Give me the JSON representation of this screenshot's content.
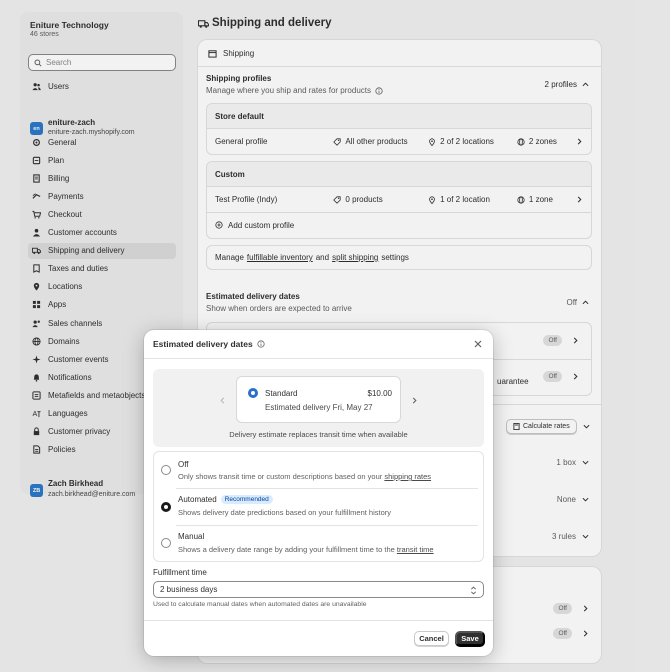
{
  "sidebar": {
    "org_name": "Eniture Technology",
    "org_stores": "46 stores",
    "search_placeholder": "Search",
    "users_label": "Users",
    "store_name": "eniture-zach",
    "store_domain": "eniture-zach.myshopify.com",
    "store_avatar": "en",
    "items": [
      {
        "label": "General",
        "icon": "gear-icon"
      },
      {
        "label": "Plan",
        "icon": "plan-icon"
      },
      {
        "label": "Billing",
        "icon": "billing-icon"
      },
      {
        "label": "Payments",
        "icon": "payments-icon"
      },
      {
        "label": "Checkout",
        "icon": "cart-icon"
      },
      {
        "label": "Customer accounts",
        "icon": "person-icon"
      },
      {
        "label": "Shipping and delivery",
        "icon": "truck-icon"
      },
      {
        "label": "Taxes and duties",
        "icon": "tax-icon"
      },
      {
        "label": "Locations",
        "icon": "location-icon"
      },
      {
        "label": "Apps",
        "icon": "apps-icon"
      },
      {
        "label": "Sales channels",
        "icon": "channels-icon"
      },
      {
        "label": "Domains",
        "icon": "globe-icon"
      },
      {
        "label": "Customer events",
        "icon": "events-icon"
      },
      {
        "label": "Notifications",
        "icon": "bell-icon"
      },
      {
        "label": "Metafields and metaobjects",
        "icon": "metafields-icon"
      },
      {
        "label": "Languages",
        "icon": "language-icon"
      },
      {
        "label": "Customer privacy",
        "icon": "lock-icon"
      },
      {
        "label": "Policies",
        "icon": "policy-icon"
      }
    ],
    "user_name": "Zach Birkhead",
    "user_email": "zach.birkhead@eniture.com",
    "user_initials": "ZB"
  },
  "page": {
    "title": "Shipping and delivery",
    "section_label": "Shipping",
    "profiles_title": "Shipping profiles",
    "profiles_sub": "Manage where you ship and rates for products",
    "profiles_count": "2 profiles",
    "store_default": "Store default",
    "general_profile": "General profile",
    "general_products": "All other products",
    "general_locations": "2 of 2 locations",
    "general_zones": "2 zones",
    "custom": "Custom",
    "test_profile": "Test Profile (Indy)",
    "test_products": "0 products",
    "test_locations": "1 of 2 location",
    "test_zones": "1 zone",
    "add_custom": "Add custom profile",
    "manage_prefix": "Manage",
    "manage_link1": "fulfillable inventory",
    "manage_and": "and",
    "manage_link2": "split shipping",
    "manage_suffix": "settings",
    "edd_title": "Estimated delivery dates",
    "edd_sub": "Show when orders are expected to arrive",
    "edd_status": "Off",
    "edd_row1_badge": "Off",
    "edd_row2_text": "uarantee",
    "edd_row2_badge": "Off",
    "calc_rates": "Calculate rates",
    "package_value": "1 box",
    "none_value": "None",
    "rules_value": "3 rules",
    "lower_badge1": "Off",
    "lower_badge2": "Off"
  },
  "modal": {
    "title": "Estimated delivery dates",
    "preview_method": "Standard",
    "preview_price": "$10.00",
    "preview_delivery": "Estimated delivery Fri, May 27",
    "preview_note": "Delivery estimate replaces transit time when available",
    "options": [
      {
        "title": "Off",
        "desc": "Only shows transit time or custom descriptions based on your",
        "link": "shipping rates",
        "selected": false
      },
      {
        "title": "Automated",
        "badge": "Recommended",
        "desc": "Shows delivery date predictions based on your fulfillment history",
        "selected": true
      },
      {
        "title": "Manual",
        "desc": "Shows a delivery date range by adding your fulfillment time to the",
        "link": "transit time",
        "selected": false
      }
    ],
    "fulfillment_label": "Fulfillment time",
    "fulfillment_value": "2 business days",
    "fulfillment_help": "Used to calculate manual dates when automated dates are unavailable",
    "cancel": "Cancel",
    "save": "Save"
  },
  "colors": {
    "accent": "#2c6ecb",
    "primary_button": "#303030",
    "recommended_bg": "#d9ecff",
    "recommended_text": "#004299"
  }
}
